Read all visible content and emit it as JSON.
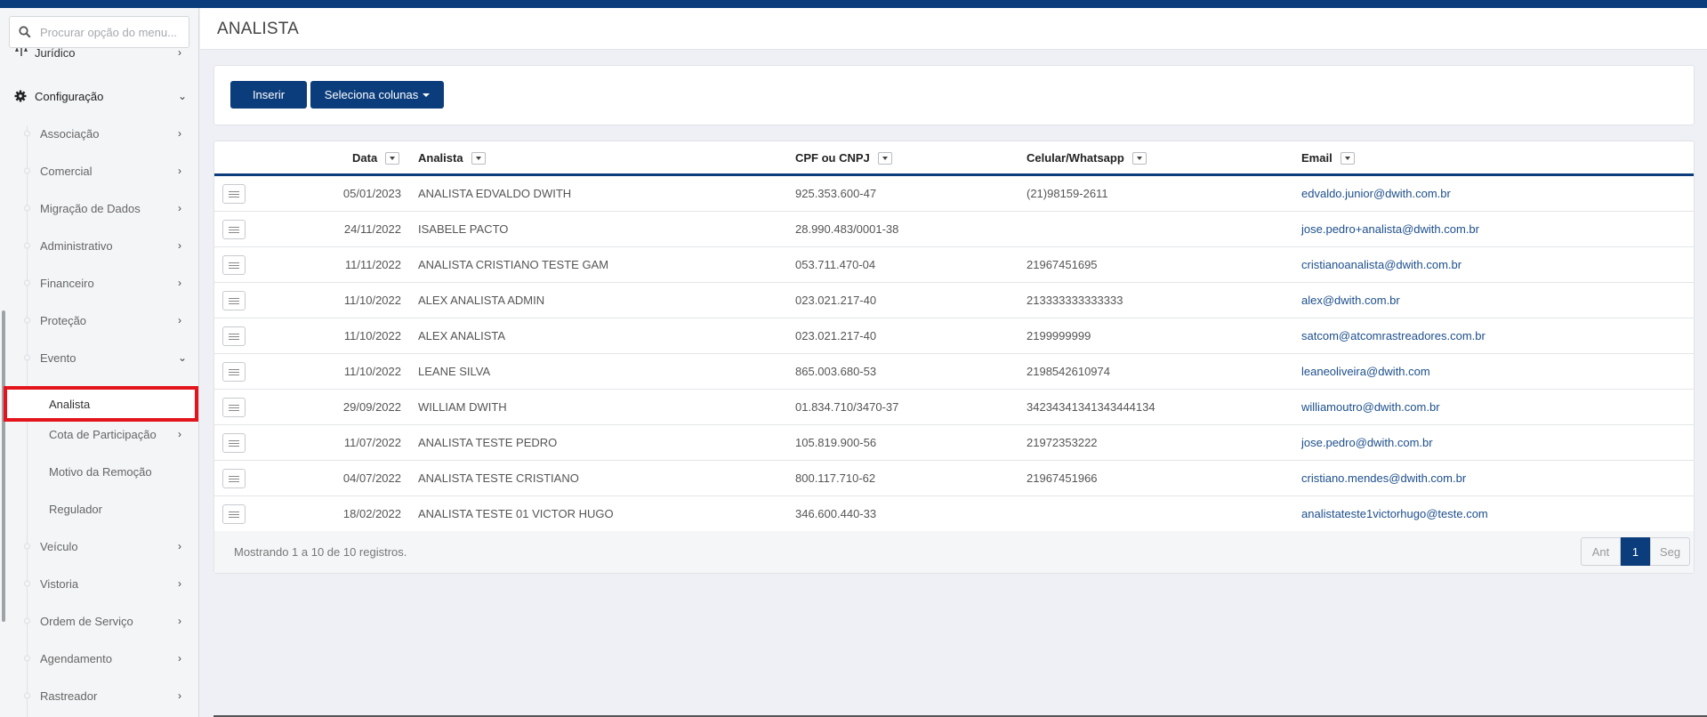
{
  "app": {
    "accent": "#0b3d7c",
    "highlight": "#e3141b"
  },
  "sidebar": {
    "search_placeholder": "Procurar opção do menu...",
    "juridico_label": "Jurídico",
    "config_label": "Configuração",
    "items": [
      {
        "label": "Associação"
      },
      {
        "label": "Comercial"
      },
      {
        "label": "Migração de Dados"
      },
      {
        "label": "Administrativo"
      },
      {
        "label": "Financeiro"
      },
      {
        "label": "Proteção"
      },
      {
        "label": "Evento"
      }
    ],
    "evento_children": [
      {
        "label": "Analista"
      },
      {
        "label": "Cota de Participação"
      },
      {
        "label": "Motivo da Remoção"
      },
      {
        "label": "Regulador"
      }
    ],
    "items_after": [
      {
        "label": "Veículo"
      },
      {
        "label": "Vistoria"
      },
      {
        "label": "Ordem de Serviço"
      },
      {
        "label": "Agendamento"
      },
      {
        "label": "Rastreador"
      }
    ]
  },
  "header": {
    "title": "ANALISTA"
  },
  "toolbar": {
    "insert_label": "Inserir",
    "columns_label": "Seleciona colunas"
  },
  "table": {
    "columns": {
      "data": "Data",
      "analista": "Analista",
      "cpf": "CPF ou CNPJ",
      "celular": "Celular/Whatsapp",
      "email": "Email"
    },
    "rows": [
      {
        "data": "05/01/2023",
        "analista": "ANALISTA EDVALDO DWITH",
        "cpf": "925.353.600-47",
        "celular": "(21)98159-2611",
        "email": "edvaldo.junior@dwith.com.br"
      },
      {
        "data": "24/11/2022",
        "analista": "ISABELE PACTO",
        "cpf": "28.990.483/0001-38",
        "celular": "",
        "email": "jose.pedro+analista@dwith.com.br"
      },
      {
        "data": "11/11/2022",
        "analista": "ANALISTA CRISTIANO TESTE GAM",
        "cpf": "053.711.470-04",
        "celular": "21967451695",
        "email": "cristianoanalista@dwith.com.br"
      },
      {
        "data": "11/10/2022",
        "analista": "ALEX ANALISTA ADMIN",
        "cpf": "023.021.217-40",
        "celular": "213333333333333",
        "email": "alex@dwith.com.br"
      },
      {
        "data": "11/10/2022",
        "analista": "ALEX ANALISTA",
        "cpf": "023.021.217-40",
        "celular": "2199999999",
        "email": "satcom@atcomrastreadores.com.br"
      },
      {
        "data": "11/10/2022",
        "analista": "LEANE SILVA",
        "cpf": "865.003.680-53",
        "celular": "2198542610974",
        "email": "leaneoliveira@dwith.com"
      },
      {
        "data": "29/09/2022",
        "analista": "WILLIAM DWITH",
        "cpf": "01.834.710/3470-37",
        "celular": "34234341341343444134",
        "email": "williamoutro@dwith.com.br"
      },
      {
        "data": "11/07/2022",
        "analista": "ANALISTA TESTE PEDRO",
        "cpf": "105.819.900-56",
        "celular": "21972353222",
        "email": "jose.pedro@dwith.com.br"
      },
      {
        "data": "04/07/2022",
        "analista": "ANALISTA TESTE CRISTIANO",
        "cpf": "800.117.710-62",
        "celular": "21967451966",
        "email": "cristiano.mendes@dwith.com.br"
      },
      {
        "data": "18/02/2022",
        "analista": "ANALISTA TESTE 01 VICTOR HUGO",
        "cpf": "346.600.440-33",
        "celular": "",
        "email": "analistateste1victorhugo@teste.com"
      }
    ],
    "footer_info": "Mostrando 1 a 10 de 10 registros.",
    "pager": {
      "prev": "Ant",
      "current": "1",
      "next": "Seg"
    }
  }
}
